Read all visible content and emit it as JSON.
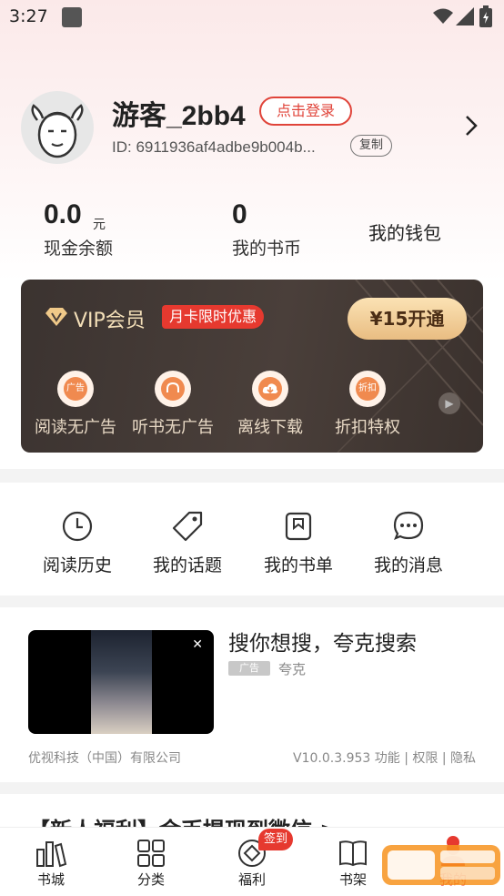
{
  "status_bar": {
    "time": "3:27"
  },
  "profile": {
    "username": "游客_2bb4",
    "login_label": "点击登录",
    "id_text": "ID: 6911936af4adbe9b004b...",
    "copy_label": "复制"
  },
  "wallet": {
    "cash_value": "0.0",
    "cash_unit": "元",
    "cash_label": "现金余额",
    "coin_value": "0",
    "coin_label": "我的书币",
    "wallet_label": "我的钱包"
  },
  "vip": {
    "title": "VIP会员",
    "promo": "月卡限时优惠",
    "button": "¥15开通",
    "perks": [
      {
        "label": "阅读无广告",
        "icon_text": "广告"
      },
      {
        "label": "听书无广告",
        "icon_text": ""
      },
      {
        "label": "离线下载",
        "icon_text": ""
      },
      {
        "label": "折扣特权",
        "icon_text": "折扣"
      }
    ]
  },
  "shortcuts": [
    {
      "label": "阅读历史",
      "icon": "clock-icon"
    },
    {
      "label": "我的话题",
      "icon": "tag-icon"
    },
    {
      "label": "我的书单",
      "icon": "bookmark-icon"
    },
    {
      "label": "我的消息",
      "icon": "chat-icon"
    }
  ],
  "ad": {
    "title": "搜你想搜，夸克搜索",
    "tag": "广告",
    "brand": "夸克",
    "company": "优视科技（中国）有限公司",
    "version_info": "V10.0.3.953  功能 | 权限 | 隐私"
  },
  "next_card": {
    "text": "【新人福利】金币提现到微信 >"
  },
  "bottom_nav": {
    "items": [
      {
        "label": "书城",
        "icon": "bookstore-icon"
      },
      {
        "label": "分类",
        "icon": "grid-icon"
      },
      {
        "label": "福利",
        "icon": "coin-icon"
      },
      {
        "label": "书架",
        "icon": "book-icon"
      },
      {
        "label": "我的",
        "icon": "user-icon"
      }
    ],
    "badge": "签到"
  },
  "colors": {
    "accent": "#e6392f",
    "vip_gold": "#f3dfb8",
    "vip_bg": "#3b3330"
  }
}
